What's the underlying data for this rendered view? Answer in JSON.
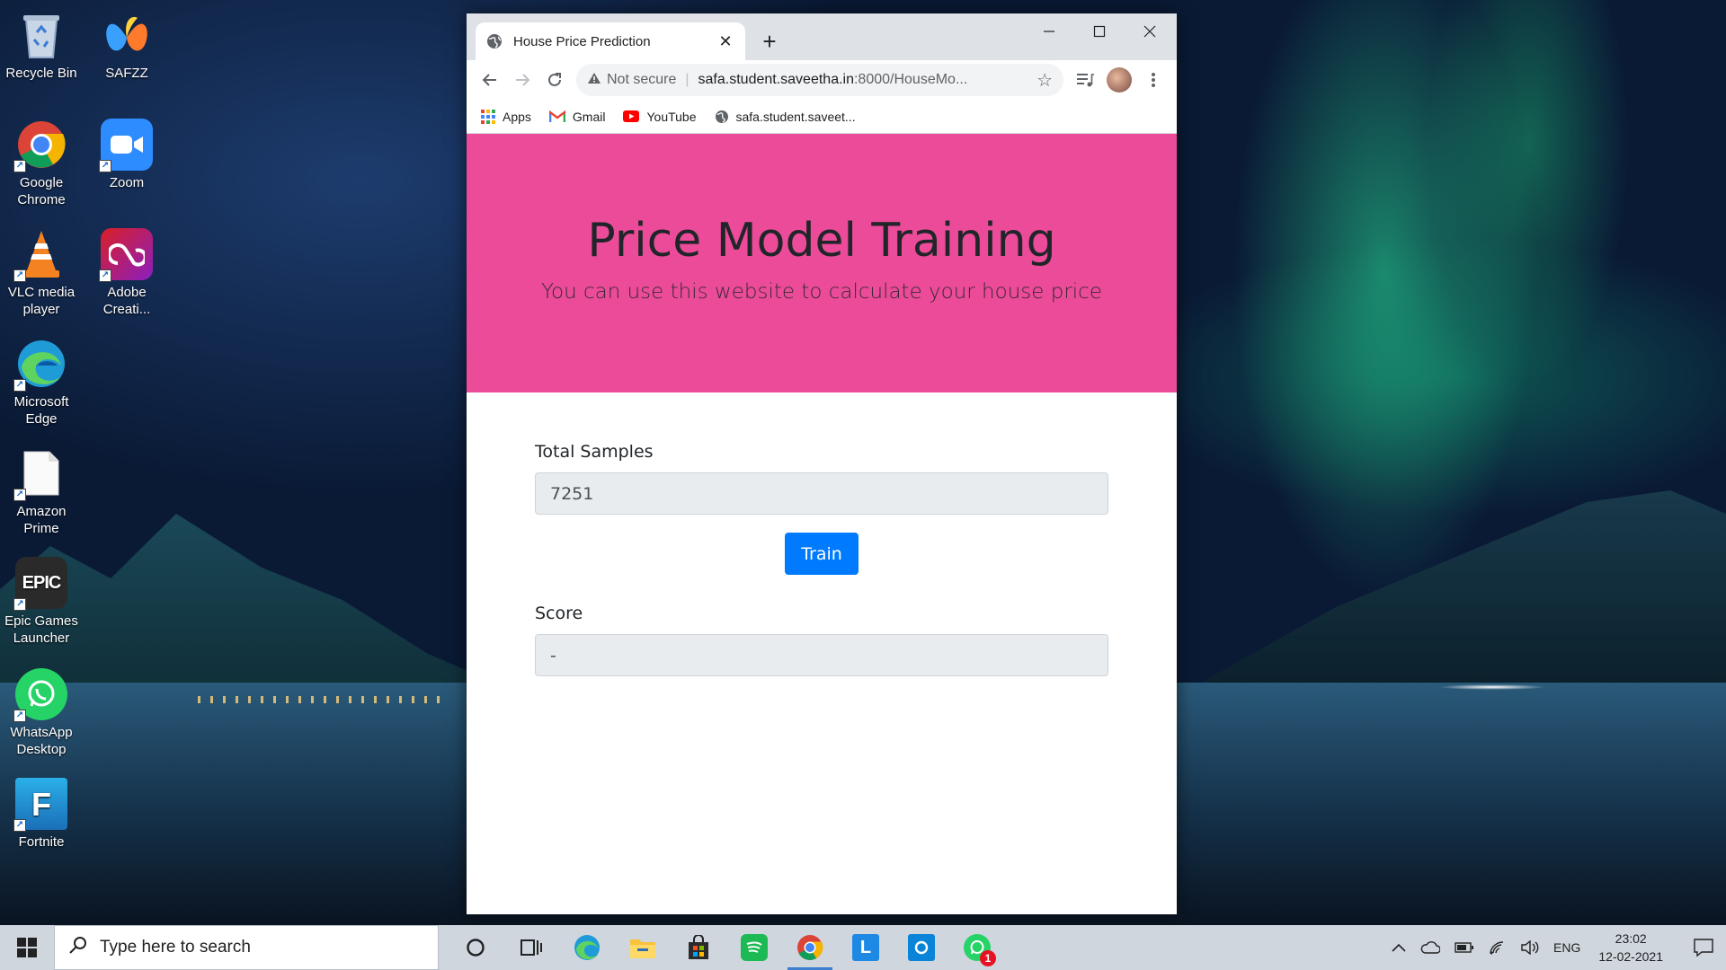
{
  "desktop": {
    "icons": [
      {
        "label": "Recycle Bin",
        "color": "#8fa8c8"
      },
      {
        "label": "SAFZZ",
        "color": "#e84b4b"
      },
      {
        "label": "Google Chrome",
        "color": "#ffffff"
      },
      {
        "label": "Zoom",
        "color": "#2d8cff"
      },
      {
        "label": "VLC media player",
        "color": "#f58220"
      },
      {
        "label": "Adobe Creati...",
        "color": "#da1f26"
      },
      {
        "label": "Microsoft Edge",
        "color": "#1f9bd8"
      },
      {
        "label": "Amazon Prime",
        "color": "#f5f5f5"
      },
      {
        "label": "Epic Games Launcher",
        "color": "#2a2a2a"
      },
      {
        "label": "WhatsApp Desktop",
        "color": "#25d366"
      },
      {
        "label": "Fortnite",
        "color": "#2ab0e8"
      }
    ],
    "epic_glyph": "EPIC",
    "fortnite_glyph": "F"
  },
  "browser": {
    "tab": {
      "title": "House Price Prediction",
      "close": "✕"
    },
    "new_tab": "+",
    "controls": {
      "minimize": "—",
      "maximize": "☐",
      "close": "✕"
    },
    "omnibox": {
      "security_label": "Not secure",
      "url_host": "safa.student.saveetha.in",
      "url_rest": ":8000/HouseMo..."
    },
    "bookmarks": [
      {
        "label": "Apps",
        "icon": "apps-grid-icon"
      },
      {
        "label": "Gmail",
        "icon": "gmail-icon"
      },
      {
        "label": "YouTube",
        "icon": "youtube-icon"
      },
      {
        "label": "safa.student.saveet...",
        "icon": "globe-icon"
      }
    ]
  },
  "page": {
    "accent_color": "#ec4b9a",
    "hero": {
      "title": "Price Model Training",
      "subtitle": "You can use this website to calculate your house price"
    },
    "form": {
      "samples_label": "Total Samples",
      "samples_value": "7251",
      "train_button": "Train",
      "score_label": "Score",
      "score_value": "-"
    }
  },
  "taskbar": {
    "search_placeholder": "Type here to search",
    "apps": [
      {
        "name": "cortana",
        "active": false
      },
      {
        "name": "task-view",
        "active": false
      },
      {
        "name": "edge",
        "active": false
      },
      {
        "name": "file-explorer",
        "active": false
      },
      {
        "name": "store",
        "active": false
      },
      {
        "name": "spotify",
        "active": false
      },
      {
        "name": "chrome",
        "active": true
      },
      {
        "name": "app-l",
        "active": false
      },
      {
        "name": "app-o",
        "active": false
      },
      {
        "name": "whatsapp",
        "active": false
      }
    ],
    "l_glyph": "L",
    "whatsapp_badge": "1",
    "tray": {
      "language": "ENG",
      "time": "23:02",
      "date": "12-02-2021"
    }
  }
}
